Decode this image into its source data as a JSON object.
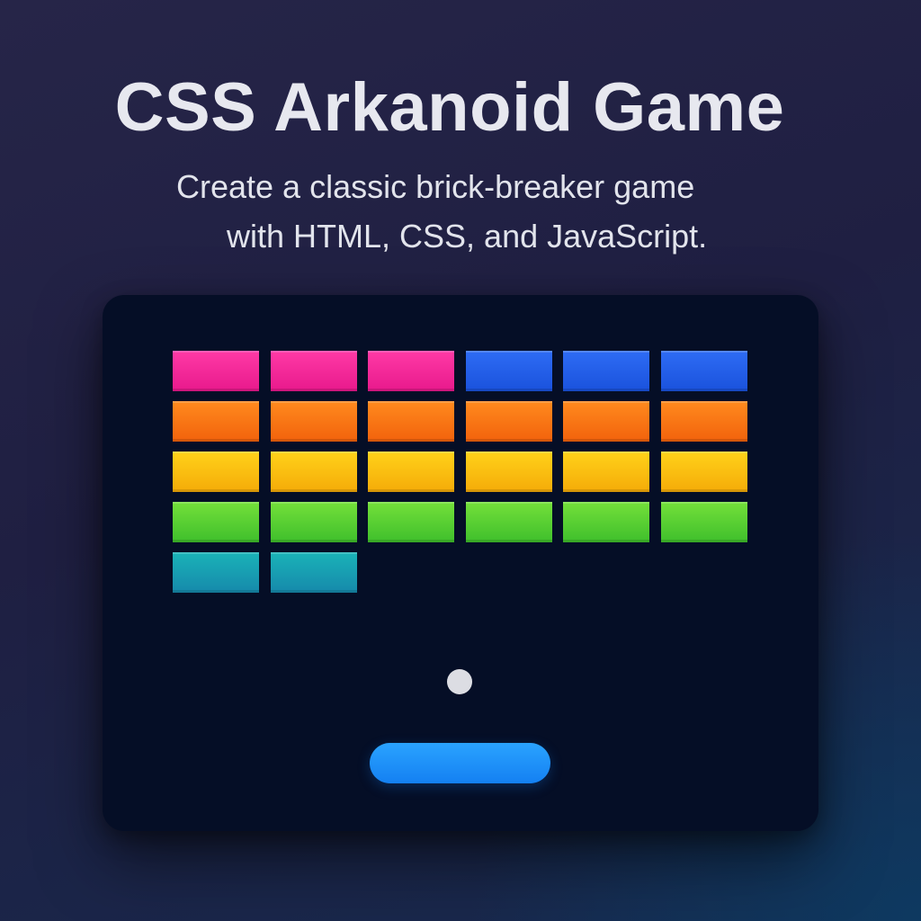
{
  "header": {
    "title": "CSS Arkanoid Game",
    "subtitle_line_1": "Create a classic brick-breaker game",
    "subtitle_line_2": "with HTML, CSS, and JavaScript."
  },
  "game": {
    "brick_rows": [
      [
        "pink",
        "pink",
        "pink",
        "blue",
        "blue",
        "blue"
      ],
      [
        "orange",
        "orange",
        "orange",
        "orange",
        "orange",
        "orange"
      ],
      [
        "yellow",
        "yellow",
        "yellow",
        "yellow",
        "yellow",
        "yellow"
      ],
      [
        "green",
        "green",
        "green",
        "green",
        "green",
        "green"
      ],
      [
        "teal",
        "teal"
      ]
    ],
    "brick_colors": {
      "pink": [
        "#ff3aa6",
        "#e8198c"
      ],
      "blue": [
        "#2e6cf5",
        "#1a52dc"
      ],
      "orange": [
        "#ff8a1e",
        "#f2620c"
      ],
      "yellow": [
        "#ffd21a",
        "#f5ab08"
      ],
      "green": [
        "#74e03a",
        "#3fbf2c"
      ],
      "teal": [
        "#1ab3b8",
        "#1689ab"
      ]
    },
    "ball_color": "#dcdde3",
    "paddle_color": "#1f90fa",
    "board_color": "#050e26"
  }
}
